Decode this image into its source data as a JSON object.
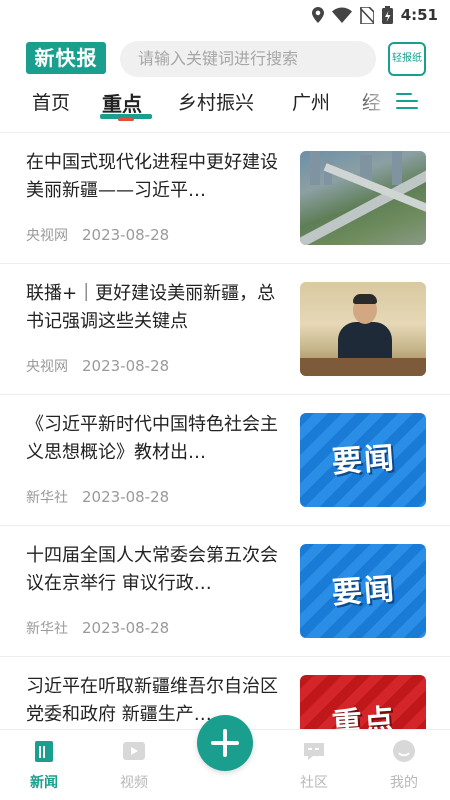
{
  "status": {
    "time": "4:51"
  },
  "header": {
    "logo": "新快报",
    "search_placeholder": "请输入关键词进行搜索",
    "paper_label": "轻报纸"
  },
  "tabs": [
    {
      "label": "首页"
    },
    {
      "label": "重点",
      "active": true
    },
    {
      "label": "乡村振兴"
    },
    {
      "label": "广州"
    },
    {
      "label": "经"
    }
  ],
  "news": [
    {
      "title": "在中国式现代化进程中更好建设美丽新疆——习近平…",
      "source": "央视网",
      "date": "2023-08-28",
      "thumb": "city"
    },
    {
      "title": "联播+｜更好建设美丽新疆，总书记强调这些关键点",
      "source": "央视网",
      "date": "2023-08-28",
      "thumb": "meeting"
    },
    {
      "title": "《习近平新时代中国特色社会主义思想概论》教材出…",
      "source": "新华社",
      "date": "2023-08-28",
      "thumb": "yaowen",
      "thumb_text": "要闻"
    },
    {
      "title": "十四届全国人大常委会第五次会议在京举行 审议行政…",
      "source": "新华社",
      "date": "2023-08-28",
      "thumb": "yaowen",
      "thumb_text": "要闻"
    },
    {
      "title": "习近平在听取新疆维吾尔自治区党委和政府 新疆生产…",
      "source": "",
      "date": "",
      "thumb": "zhongdian",
      "thumb_text": "重点"
    }
  ],
  "bottom_nav": [
    {
      "label": "新闻",
      "active": true,
      "icon": "news-icon"
    },
    {
      "label": "视频",
      "icon": "video-icon"
    },
    {
      "label": "社区",
      "icon": "community-icon"
    },
    {
      "label": "我的",
      "icon": "profile-icon"
    }
  ],
  "colors": {
    "accent": "#1a9e8e",
    "underline_red": "#e34d3d",
    "meta": "#9a9a9a"
  }
}
